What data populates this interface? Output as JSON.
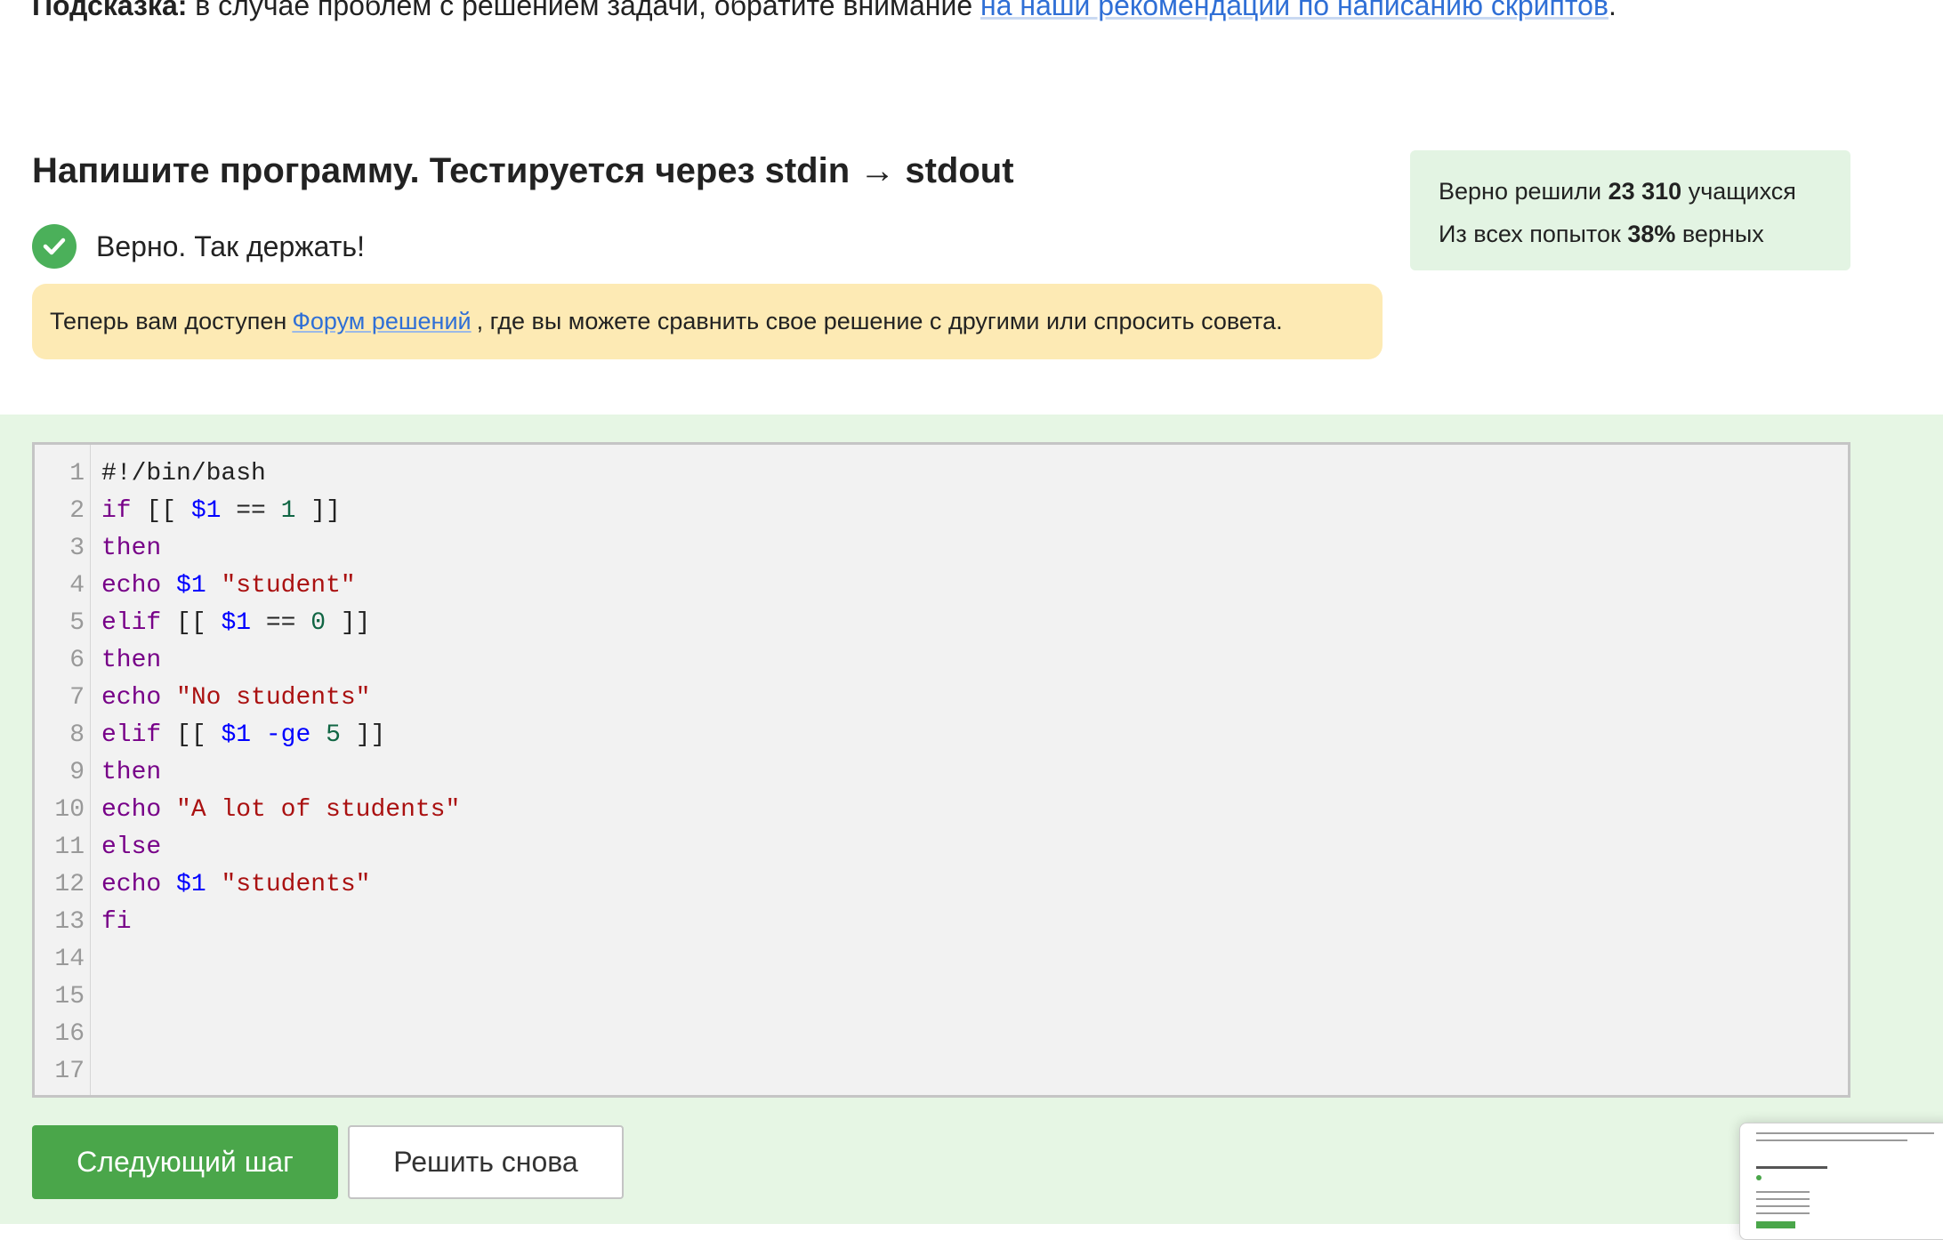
{
  "hint": {
    "label": "Подсказка:",
    "text": " в случае проблем с решением задачи, обратите внимание ",
    "link": "на наши рекомендации по написанию скриптов",
    "end": "."
  },
  "task": {
    "title": "Напишите программу. Тестируется через stdin → stdout",
    "verdict": "Верно. Так держать!"
  },
  "forum": {
    "before": "Теперь вам доступен",
    "link": "Форум решений",
    "after": ", где вы можете сравнить свое решение с другими или спросить совета."
  },
  "stats": {
    "solved_prefix": "Верно решили ",
    "solved_count": "23 310",
    "solved_suffix": " учащихся",
    "attempts_prefix": "Из всех попыток ",
    "attempts_percent": "38%",
    "attempts_suffix": " верных"
  },
  "editor": {
    "line_numbers": [
      "1",
      "2",
      "3",
      "4",
      "5",
      "6",
      "7",
      "8",
      "9",
      "10",
      "11",
      "12",
      "13",
      "14",
      "15",
      "16",
      "17"
    ],
    "lines": [
      [
        {
          "t": "#!/bin/bash",
          "c": "plain"
        }
      ],
      [
        {
          "t": "if",
          "c": "kw"
        },
        {
          "t": " [[ ",
          "c": "plain"
        },
        {
          "t": "$1",
          "c": "var"
        },
        {
          "t": " == ",
          "c": "plain"
        },
        {
          "t": "1",
          "c": "num"
        },
        {
          "t": " ]]",
          "c": "plain"
        }
      ],
      [
        {
          "t": "then",
          "c": "kw"
        }
      ],
      [
        {
          "t": "echo",
          "c": "kw"
        },
        {
          "t": " ",
          "c": "plain"
        },
        {
          "t": "$1",
          "c": "var"
        },
        {
          "t": " ",
          "c": "plain"
        },
        {
          "t": "\"student\"",
          "c": "str"
        }
      ],
      [
        {
          "t": "elif",
          "c": "kw"
        },
        {
          "t": " [[ ",
          "c": "plain"
        },
        {
          "t": "$1",
          "c": "var"
        },
        {
          "t": " == ",
          "c": "plain"
        },
        {
          "t": "0",
          "c": "num"
        },
        {
          "t": " ]]",
          "c": "plain"
        }
      ],
      [
        {
          "t": "then",
          "c": "kw"
        }
      ],
      [
        {
          "t": "echo",
          "c": "kw"
        },
        {
          "t": " ",
          "c": "plain"
        },
        {
          "t": "\"No students\"",
          "c": "str"
        }
      ],
      [
        {
          "t": "elif",
          "c": "kw"
        },
        {
          "t": " [[ ",
          "c": "plain"
        },
        {
          "t": "$1",
          "c": "var"
        },
        {
          "t": " ",
          "c": "plain"
        },
        {
          "t": "-ge",
          "c": "var"
        },
        {
          "t": " ",
          "c": "plain"
        },
        {
          "t": "5",
          "c": "num"
        },
        {
          "t": " ]]",
          "c": "plain"
        }
      ],
      [
        {
          "t": "then",
          "c": "kw"
        }
      ],
      [
        {
          "t": "echo",
          "c": "kw"
        },
        {
          "t": " ",
          "c": "plain"
        },
        {
          "t": "\"A lot of students\"",
          "c": "str"
        }
      ],
      [
        {
          "t": "else",
          "c": "kw"
        }
      ],
      [
        {
          "t": "echo",
          "c": "kw"
        },
        {
          "t": " ",
          "c": "plain"
        },
        {
          "t": "$1",
          "c": "var"
        },
        {
          "t": " ",
          "c": "plain"
        },
        {
          "t": "\"students\"",
          "c": "str"
        }
      ],
      [
        {
          "t": "fi",
          "c": "kw"
        }
      ],
      [],
      [],
      [],
      []
    ]
  },
  "buttons": {
    "next": "Следующий шаг",
    "retry": "Решить снова"
  },
  "colors": {
    "accent_green": "#4aa64a",
    "link_blue": "#2f6fd6",
    "banner_yellow": "#fdeab4",
    "panel_green": "#e6f6e4"
  }
}
